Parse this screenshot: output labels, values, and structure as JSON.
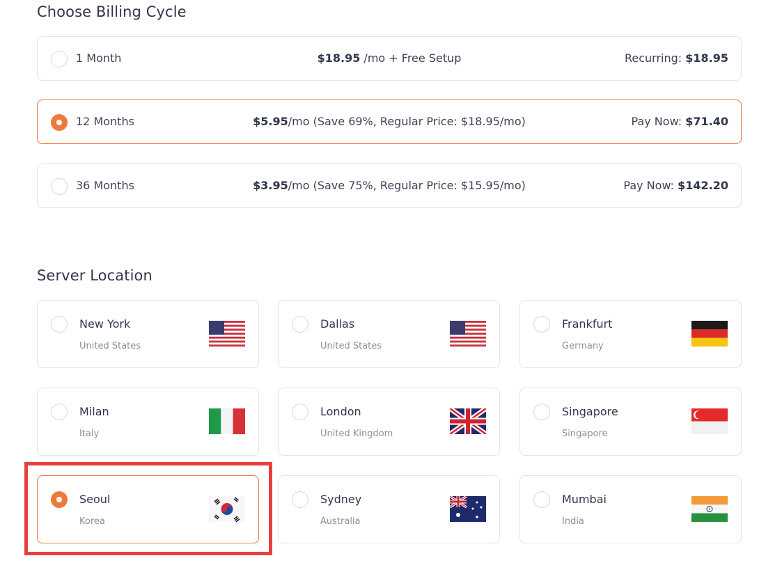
{
  "billing": {
    "title": "Choose Billing Cycle",
    "options": [
      {
        "label": "1 Month",
        "price_bold": "$18.95",
        "price_rest": " /mo + Free Setup",
        "right_label": "Recurring: ",
        "right_value": "$18.95",
        "selected": false
      },
      {
        "label": "12 Months",
        "price_bold": "$5.95",
        "price_rest": "/mo (Save 69%, Regular Price: $18.95/mo)",
        "right_label": "Pay Now: ",
        "right_value": "$71.40",
        "selected": true
      },
      {
        "label": "36 Months",
        "price_bold": "$3.95",
        "price_rest": "/mo (Save 75%, Regular Price: $15.95/mo)",
        "right_label": "Pay Now: ",
        "right_value": "$142.20",
        "selected": false
      }
    ]
  },
  "location": {
    "title": "Server Location",
    "items": [
      {
        "city": "New York",
        "country": "United States",
        "flag": "us-flag-icon",
        "selected": false
      },
      {
        "city": "Dallas",
        "country": "United States",
        "flag": "us-flag-icon",
        "selected": false
      },
      {
        "city": "Frankfurt",
        "country": "Germany",
        "flag": "germany-flag-icon",
        "selected": false
      },
      {
        "city": "Milan",
        "country": "Italy",
        "flag": "italy-flag-icon",
        "selected": false
      },
      {
        "city": "London",
        "country": "United Kingdom",
        "flag": "uk-flag-icon",
        "selected": false
      },
      {
        "city": "Singapore",
        "country": "Singapore",
        "flag": "singapore-flag-icon",
        "selected": false
      },
      {
        "city": "Seoul",
        "country": "Korea",
        "flag": "korea-flag-icon",
        "selected": true
      },
      {
        "city": "Sydney",
        "country": "Australia",
        "flag": "australia-flag-icon",
        "selected": false
      },
      {
        "city": "Mumbai",
        "country": "India",
        "flag": "india-flag-icon",
        "selected": false
      }
    ]
  },
  "colors": {
    "accent": "#ee7a3a",
    "highlight": "#e8403f",
    "border": "#e3e5ea",
    "text": "#3d4358",
    "muted": "#8a8f9e"
  }
}
